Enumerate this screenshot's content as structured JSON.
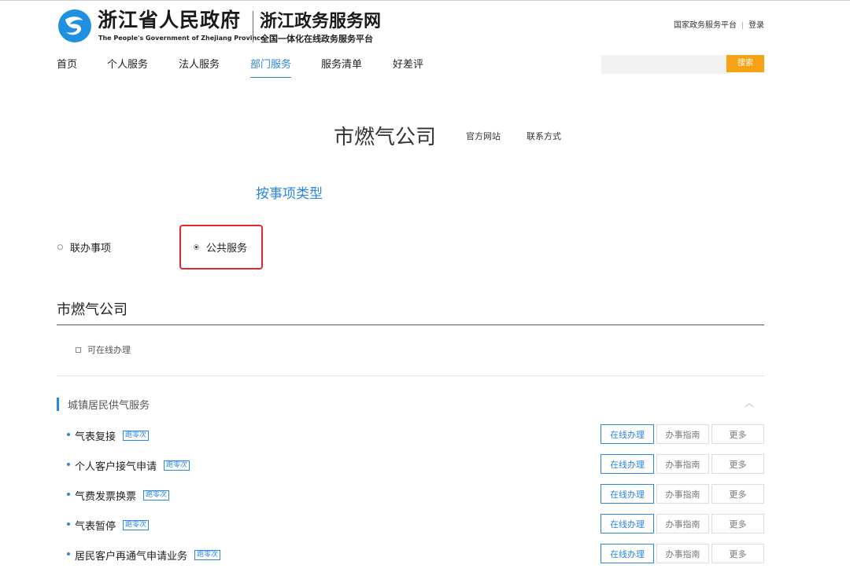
{
  "header": {
    "gov_name_cn": "浙江省人民政府",
    "gov_name_en": "The People's Government of Zhejiang Province",
    "service_name": "浙江政务服务网",
    "service_subtitle": "全国一体化在线政务服务平台",
    "top_links": [
      "国家政务服务平台",
      "登录"
    ]
  },
  "nav": {
    "items": [
      "首页",
      "个人服务",
      "法人服务",
      "部门服务",
      "服务清单",
      "好差评"
    ],
    "active": "部门服务"
  },
  "search": {
    "button_label": "搜索",
    "value": ""
  },
  "department": {
    "name": "市燃气公司",
    "links": [
      "官方网站",
      "联系方式"
    ]
  },
  "category_label": "按事项类型",
  "radios": [
    {
      "label": "联办事项",
      "selected": false
    },
    {
      "label": "公共服务",
      "selected": true
    }
  ],
  "section": {
    "title": "市燃气公司",
    "online_filter_label": "可在线办理",
    "group_title": "城镇居民供气服务"
  },
  "services": [
    {
      "name": "气表复接",
      "tag": "跑零次"
    },
    {
      "name": "个人客户接气申请",
      "tag": "跑零次"
    },
    {
      "name": "气费发票换票",
      "tag": "跑零次"
    },
    {
      "name": "气表暂停",
      "tag": "跑零次"
    },
    {
      "name": "居民客户再通气申请业务",
      "tag": "跑零次"
    }
  ],
  "service_buttons": {
    "online": "在线办理",
    "guide": "办事指南",
    "more": "更多"
  },
  "colors": {
    "accent": "#2a86e3",
    "search_button": "#f5a315",
    "highlight": "#e0292f"
  }
}
